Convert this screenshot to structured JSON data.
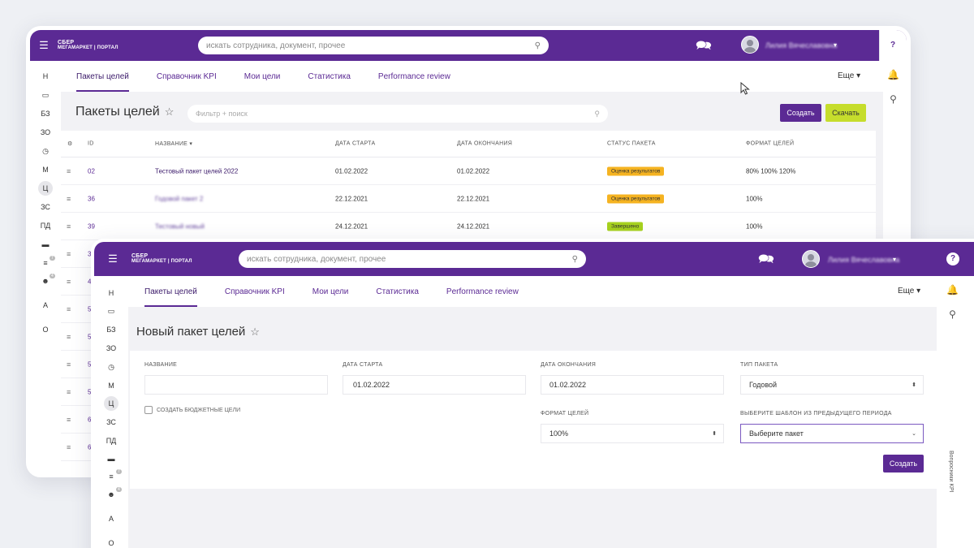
{
  "brand": {
    "line1": "СБЕР",
    "line2": "МЕГАМАРКЕТ | ПОРТАЛ",
    "accent": "#5b2a94",
    "lime": "#c6dd2c"
  },
  "search": {
    "placeholder": "искать сотрудника, документ, прочее"
  },
  "user": {
    "name": "Лилия Вячеславовна"
  },
  "help_label": "?",
  "tabs": [
    "Пакеты целей",
    "Справочник KPI",
    "Мои цели",
    "Статистика",
    "Performance review"
  ],
  "more_label": "Еще",
  "left_nav": [
    "Н",
    "БЗ",
    "ЗО",
    "М",
    "Ц",
    "ЗС",
    "ПД"
  ],
  "left_nav_lower": [
    "А",
    "О"
  ],
  "badges": [
    "7",
    "4"
  ],
  "list_page": {
    "title": "Пакеты целей",
    "filter_placeholder": "Фильтр + поиск",
    "create_label": "Создать",
    "download_label": "Скачать",
    "columns": [
      "ID",
      "НАЗВАНИЕ",
      "ДАТА СТАРТА",
      "ДАТА ОКОНЧАНИЯ",
      "СТАТУС ПАКЕТА",
      "ФОРМАТ ЦЕЛЕЙ"
    ],
    "rows": [
      {
        "id": "02",
        "name": "Тестовый пакет целей 2022",
        "start": "01.02.2022",
        "end": "01.02.2022",
        "status": "Оценка результатов",
        "status_color": "orange",
        "format": "80% 100% 120%"
      },
      {
        "id": "36",
        "name": "Годовой пакет 2",
        "start": "22.12.2021",
        "end": "22.12.2021",
        "status": "Оценка результатов",
        "status_color": "orange",
        "format": "100%"
      },
      {
        "id": "39",
        "name": "Тестовый новый",
        "start": "24.12.2021",
        "end": "24.12.2021",
        "status": "Завершено",
        "status_color": "green",
        "format": "100%"
      }
    ],
    "hidden_row_ids": [
      "3",
      "4",
      "5",
      "5",
      "5",
      "5",
      "6",
      "6"
    ]
  },
  "form_page": {
    "title": "Новый пакет целей",
    "labels": {
      "name": "НАЗВАНИЕ",
      "start": "ДАТА СТАРТА",
      "end": "ДАТА ОКОНЧАНИЯ",
      "type": "ТИП ПАКЕТА",
      "format": "ФОРМАТ ЦЕЛЕЙ",
      "template": "ВЫБЕРИТЕ ШАБЛОН ИЗ ПРЕДЫДУЩЕГО ПЕРИОДА"
    },
    "values": {
      "name": "",
      "start": "01.02.2022",
      "end": "01.02.2022",
      "type": "Годовой",
      "format": "100%",
      "template": "Выберите пакет"
    },
    "checkbox_label": "СОЗДАТЬ БЮДЖЕТНЫЕ ЦЕЛИ",
    "create_label": "Создать",
    "side_label": "Вопросники KPI"
  }
}
